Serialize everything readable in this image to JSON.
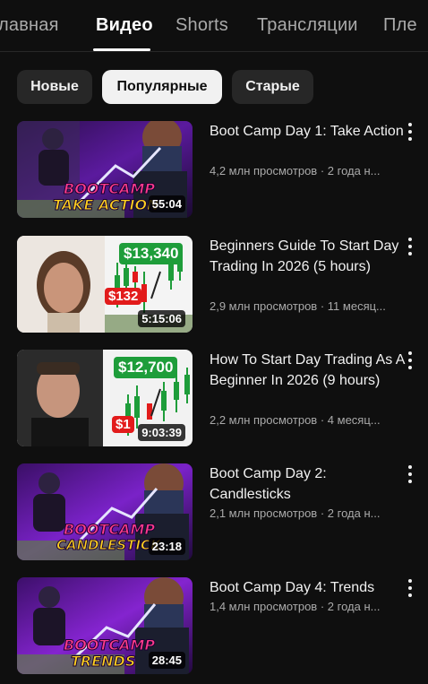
{
  "tabs": [
    {
      "label": "лавная"
    },
    {
      "label": "Видео"
    },
    {
      "label": "Shorts"
    },
    {
      "label": "Трансляции"
    },
    {
      "label": "Пле"
    }
  ],
  "chips": [
    {
      "label": "Новые"
    },
    {
      "label": "Популярные"
    },
    {
      "label": "Старые"
    }
  ],
  "videos": [
    {
      "title": "Boot Camp Day 1: Take Action",
      "views": "4,2 млн просмотров",
      "age": "2 года н...",
      "duration": "55:04",
      "thumb_top": "BOOTCAMP",
      "thumb_bottom": "TAKE ACTION"
    },
    {
      "title": "Beginners Guide To Start Day Trading In 2026 (5 hours)",
      "views": "2,9 млн просмотров",
      "age": "11 месяц...",
      "duration": "5:15:06",
      "thumb_green": "$13,340",
      "thumb_red": "$132"
    },
    {
      "title": "How To Start Day Trading As A Beginner In 2026 (9 hours)",
      "views": "2,2 млн просмотров",
      "age": "4 месяц...",
      "duration": "9:03:39",
      "thumb_green": "$12,700",
      "thumb_red": "$1"
    },
    {
      "title": "Boot Camp Day 2: Candlesticks",
      "views": "2,1 млн просмотров",
      "age": "2 года н...",
      "duration": "23:18",
      "thumb_top": "BOOTCAMP",
      "thumb_bottom": "CANDLESTICK"
    },
    {
      "title": "Boot Camp Day 4: Trends",
      "views": "1,4 млн просмотров",
      "age": "2 года н...",
      "duration": "28:45",
      "thumb_top": "BOOTCAMP",
      "thumb_bottom": "TRENDS"
    }
  ],
  "meta_separator": "·",
  "colors": {
    "background": "#0f0f0f",
    "chip_bg": "#272727",
    "chip_selected_bg": "#f1f1f1",
    "meta_text": "#aaaaaa",
    "green_price": "#1e9d3a",
    "red_price": "#e21b1b",
    "bootcamp_purple": "#6a1fb3"
  },
  "icons": {
    "video_menu": "kebab-menu-icon"
  }
}
